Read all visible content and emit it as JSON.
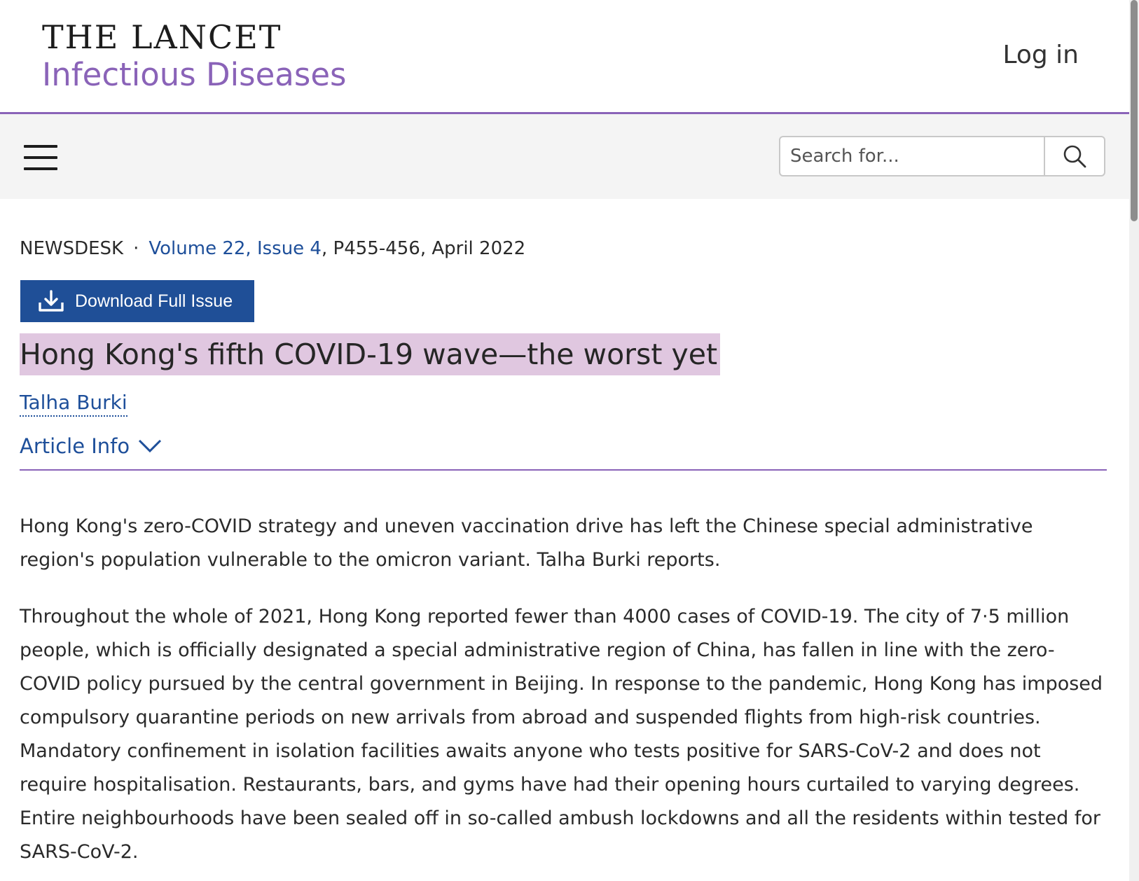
{
  "header": {
    "brand_top": "THE LANCET",
    "brand_sub": "Infectious Diseases",
    "login_label": "Log in"
  },
  "navbar": {
    "search_placeholder": "Search for..."
  },
  "article": {
    "section": "NEWSDESK",
    "separator": "·",
    "volume_issue": "Volume 22, Issue 4",
    "pages_date": ", P455-456, April 2022",
    "download_label": "Download Full Issue",
    "title": "Hong Kong's fifth COVID-19 wave—the worst yet",
    "author": "Talha Burki",
    "article_info_label": "Article Info",
    "paragraphs": [
      "Hong Kong's zero-COVID strategy and uneven vaccination drive has left the Chinese special administrative region's population vulnerable to the omicron variant. Talha Burki reports.",
      "Throughout the whole of 2021, Hong Kong reported fewer than 4000 cases of COVID-19. The city of 7·5 million people, which is officially designated a special administrative region of China, has fallen in line with the zero-COVID policy pursued by the central government in Beijing. In response to the pandemic, Hong Kong has imposed compulsory quarantine periods on new arrivals from abroad and suspended flights from high-risk countries. Mandatory confinement in isolation facilities awaits anyone who tests positive for SARS-CoV-2 and does not require hospitalisation. Restaurants, bars, and gyms have had their opening hours curtailed to varying degrees. Entire neighbourhoods have been sealed off in so-called ambush lockdowns and all the residents within tested for SARS-CoV-2."
    ]
  },
  "colors": {
    "accent_purple": "#8a63b8",
    "link_blue": "#1e4f9a",
    "button_blue": "#1f4f97",
    "title_highlight": "#e0c7e0"
  },
  "icons": [
    "hamburger-menu-icon",
    "search-icon",
    "download-icon",
    "chevron-down-icon"
  ]
}
